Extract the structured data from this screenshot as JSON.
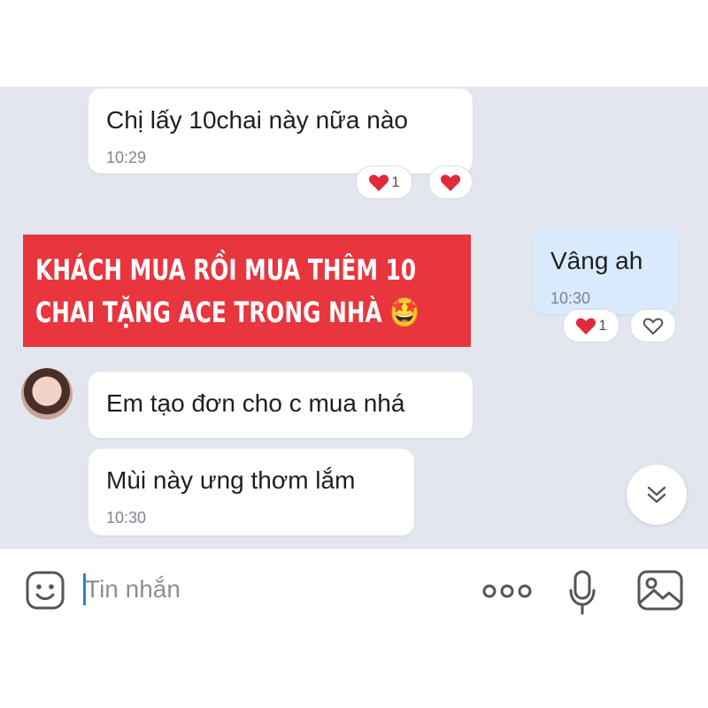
{
  "messages": [
    {
      "text": "Chị lấy 10chai này nữa nào",
      "time": "10:29",
      "reaction_count": "1"
    },
    {
      "text": "Vâng ah",
      "time": "10:30",
      "reaction_count": "1"
    },
    {
      "text": "Em tạo đơn cho c mua nhá"
    },
    {
      "text": "Mùi này ưng thơm lắm",
      "time": "10:30"
    }
  ],
  "banner": {
    "line1": "KHÁCH MUA RỒI MUA THÊM 10",
    "line2": "CHAI TẶNG ACE TRONG NHÀ",
    "emoji": "🤩"
  },
  "composer": {
    "placeholder": "Tin nhắn"
  },
  "icons": {
    "sticker": "smiley-sticker-icon",
    "more": "more-dots-icon",
    "mic": "microphone-icon",
    "image": "image-gallery-icon",
    "scroll": "double-chevron-down-icon",
    "heart_red": "heart-icon",
    "heart_outline": "heart-outline-icon"
  },
  "colors": {
    "chat_bg": "#e3e6ee",
    "own_bubble": "#d9eafc",
    "banner": "#e8353e",
    "heart": "#e0293b",
    "accent": "#2b7de0"
  }
}
